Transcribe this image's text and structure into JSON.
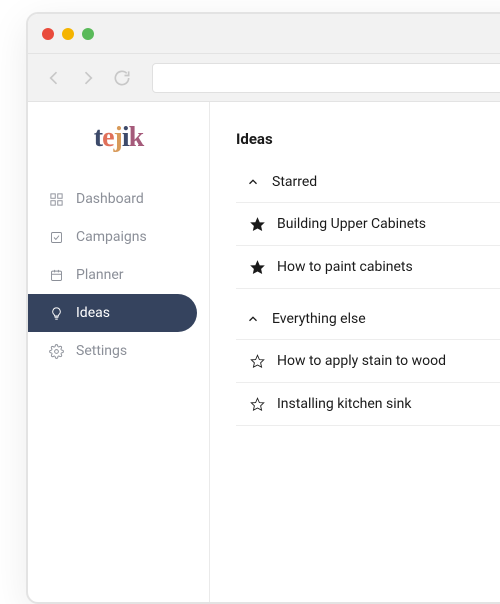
{
  "logo": {
    "text": "tejik"
  },
  "sidebar": {
    "items": [
      {
        "label": "Dashboard"
      },
      {
        "label": "Campaigns"
      },
      {
        "label": "Planner"
      },
      {
        "label": "Ideas"
      },
      {
        "label": "Settings"
      }
    ]
  },
  "main": {
    "title": "Ideas",
    "groups": [
      {
        "label": "Starred",
        "items": [
          {
            "title": "Building Upper Cabinets",
            "starred": true
          },
          {
            "title": "How to paint cabinets",
            "starred": true
          }
        ]
      },
      {
        "label": "Everything else",
        "items": [
          {
            "title": "How to apply stain to wood",
            "starred": false
          },
          {
            "title": "Installing kitchen sink",
            "starred": false
          }
        ]
      }
    ]
  }
}
